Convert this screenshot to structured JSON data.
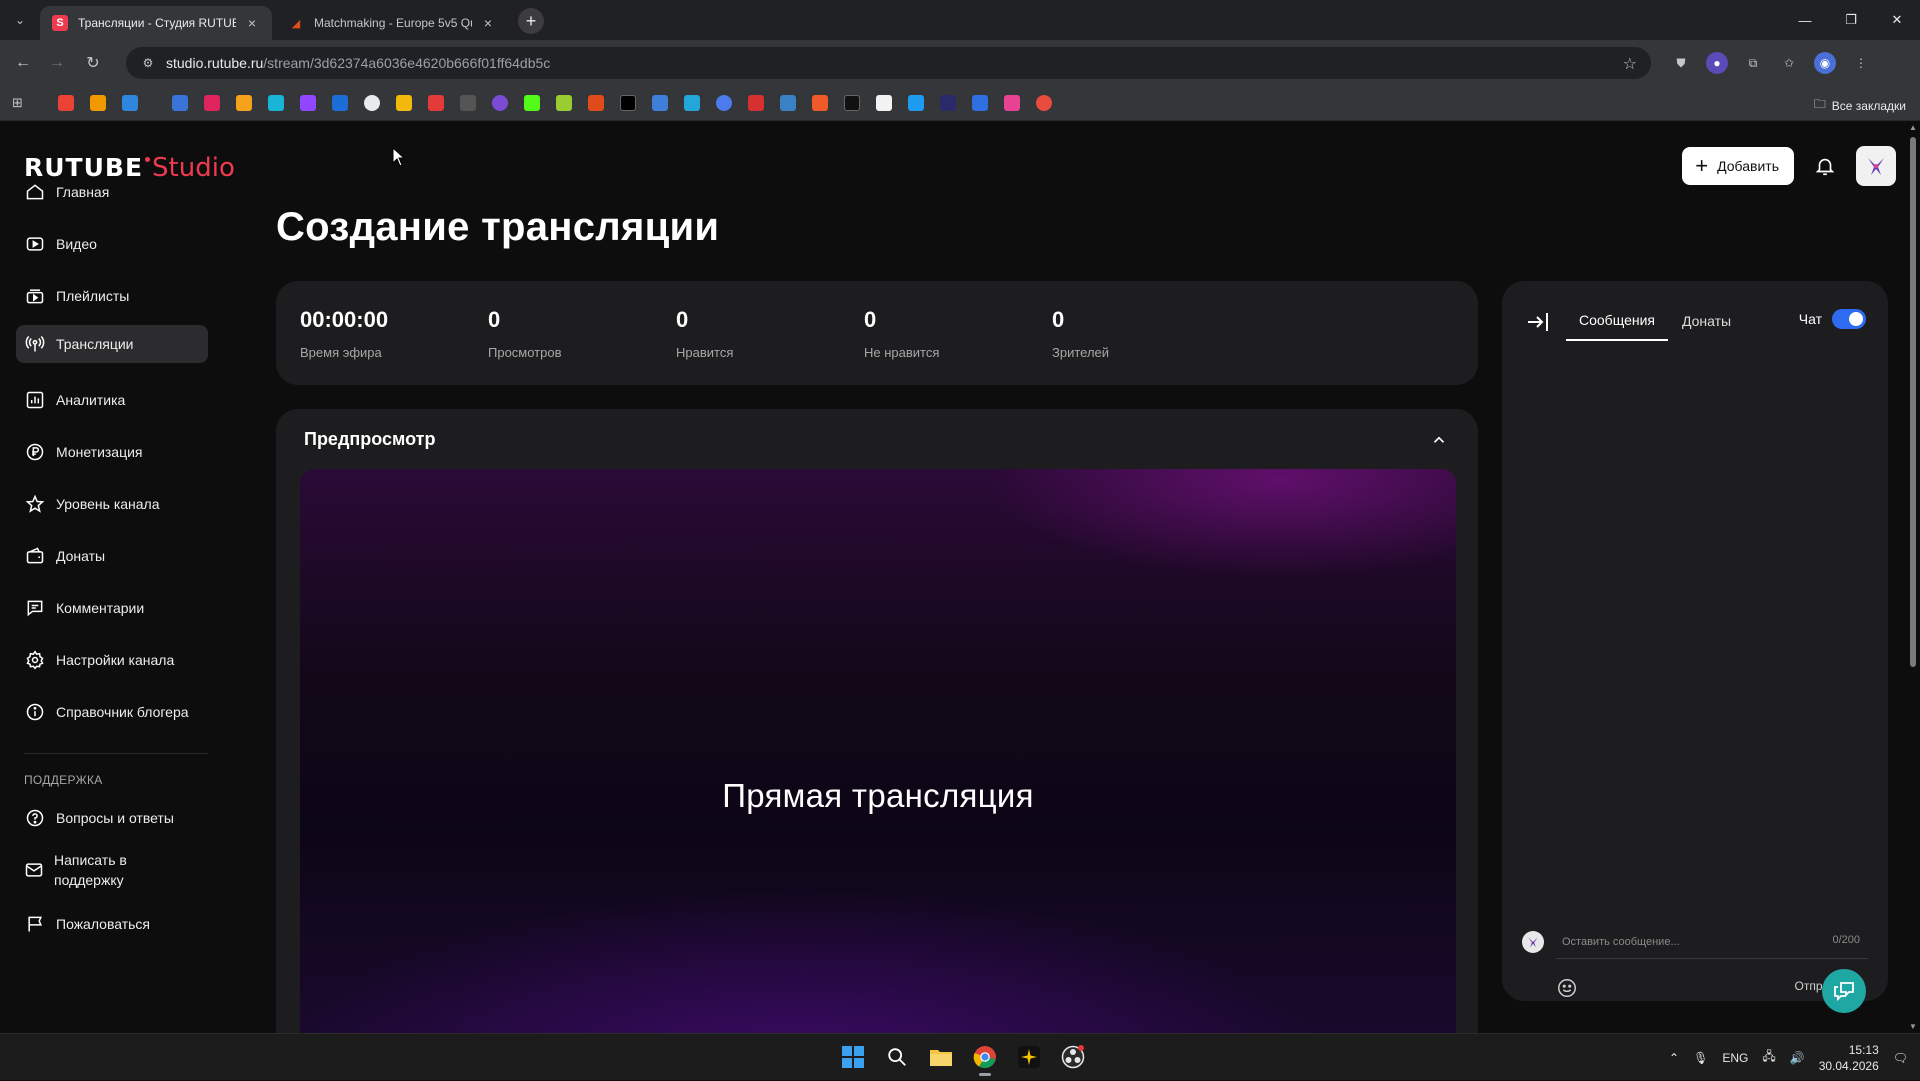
{
  "browser": {
    "tabs": [
      {
        "title": "Трансляции - Студия RUTUBE",
        "favicon": "S",
        "favicon_color": "#ee3a4f",
        "active": true
      },
      {
        "title": "Matchmaking - Europe 5v5 Qu",
        "favicon": "◢",
        "favicon_color": "#e04b1a",
        "active": false
      }
    ],
    "url_host": "studio.rutube.ru",
    "url_path": "/stream/3d62374a6036e4620b666f01ff64db5c",
    "all_bookmarks": "Все закладки"
  },
  "app": {
    "logo_main": "RUTUBE",
    "logo_sub": "Studio",
    "add_button": "Добавить",
    "page_title": "Создание трансляции",
    "nav": [
      {
        "label": "Главная",
        "icon": "home-icon"
      },
      {
        "label": "Видео",
        "icon": "video-icon"
      },
      {
        "label": "Плейлисты",
        "icon": "playlist-icon"
      },
      {
        "label": "Трансляции",
        "icon": "broadcast-icon"
      },
      {
        "label": "Аналитика",
        "icon": "analytics-icon"
      },
      {
        "label": "Монетизация",
        "icon": "ruble-icon"
      },
      {
        "label": "Уровень канала",
        "icon": "star-icon"
      },
      {
        "label": "Донаты",
        "icon": "wallet-icon"
      },
      {
        "label": "Комментарии",
        "icon": "comment-icon"
      },
      {
        "label": "Настройки канала",
        "icon": "gear-icon"
      },
      {
        "label": "Справочник блогера",
        "icon": "info-icon"
      }
    ],
    "support_title": "ПОДДЕРЖКА",
    "support": [
      {
        "label": "Вопросы и ответы",
        "icon": "question-icon"
      },
      {
        "label": "Написать в поддержку",
        "icon": "mail-icon"
      },
      {
        "label": "Пожаловаться",
        "icon": "flag-icon"
      }
    ],
    "stats": [
      {
        "value": "00:00:00",
        "label": "Время эфира"
      },
      {
        "value": "0",
        "label": "Просмотров"
      },
      {
        "value": "0",
        "label": "Нравится"
      },
      {
        "value": "0",
        "label": "Не нравится"
      },
      {
        "value": "0",
        "label": "Зрителей"
      }
    ],
    "preview_title": "Предпросмотр",
    "preview_text": "Прямая трансляция",
    "chat": {
      "tab_messages": "Сообщения",
      "tab_donations": "Донаты",
      "toggle_label": "Чат",
      "toggle_on": true,
      "input_placeholder": "Оставить сообщение...",
      "counter": "0/200",
      "send": "Отправить"
    },
    "colors": {
      "accent": "#ee3a4f",
      "toggle": "#2e6bf0",
      "help": "#1fa7a4"
    }
  },
  "taskbar": {
    "lang": "ENG",
    "time": "15:13",
    "date": "30.04.2026"
  }
}
